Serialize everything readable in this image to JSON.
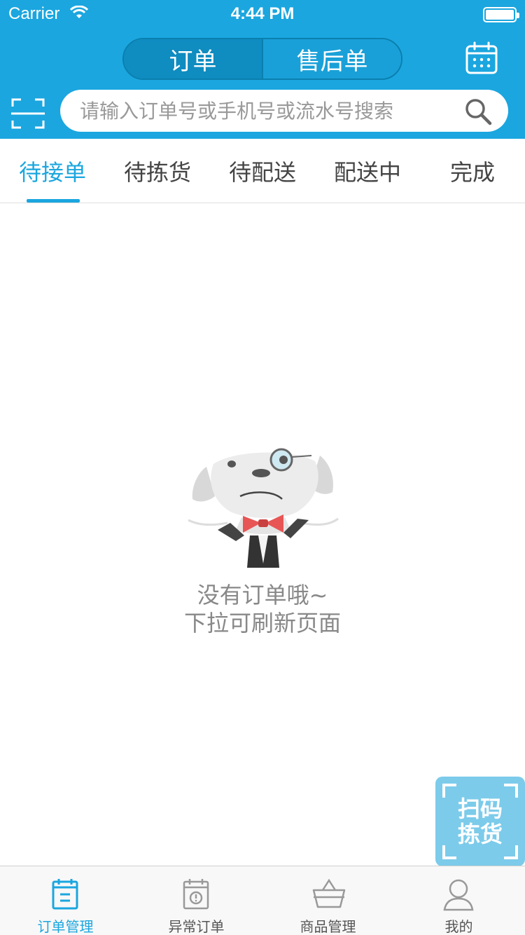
{
  "status_bar": {
    "carrier": "Carrier",
    "time": "4:44 PM"
  },
  "header": {
    "segments": [
      {
        "label": "订单",
        "active": true
      },
      {
        "label": "售后单",
        "active": false
      }
    ],
    "search_placeholder": "请输入订单号或手机号或流水号搜索"
  },
  "tabs": [
    {
      "label": "待接单",
      "active": true
    },
    {
      "label": "待拣货",
      "active": false
    },
    {
      "label": "待配送",
      "active": false
    },
    {
      "label": "配送中",
      "active": false
    },
    {
      "label": "完成",
      "active": false
    }
  ],
  "empty_state": {
    "line1": "没有订单哦~",
    "line2": "下拉可刷新页面"
  },
  "floating_button": {
    "line1": "扫码",
    "line2": "拣货"
  },
  "tab_bar": [
    {
      "label": "订单管理",
      "icon": "order-list-icon",
      "active": true
    },
    {
      "label": "异常订单",
      "icon": "exception-order-icon",
      "active": false
    },
    {
      "label": "商品管理",
      "icon": "basket-icon",
      "active": false
    },
    {
      "label": "我的",
      "icon": "user-icon",
      "active": false
    }
  ],
  "colors": {
    "primary": "#1ba6df",
    "segment_active": "#0f8cc0",
    "floating_button": "#7ccbea",
    "text_gray": "#888888"
  }
}
